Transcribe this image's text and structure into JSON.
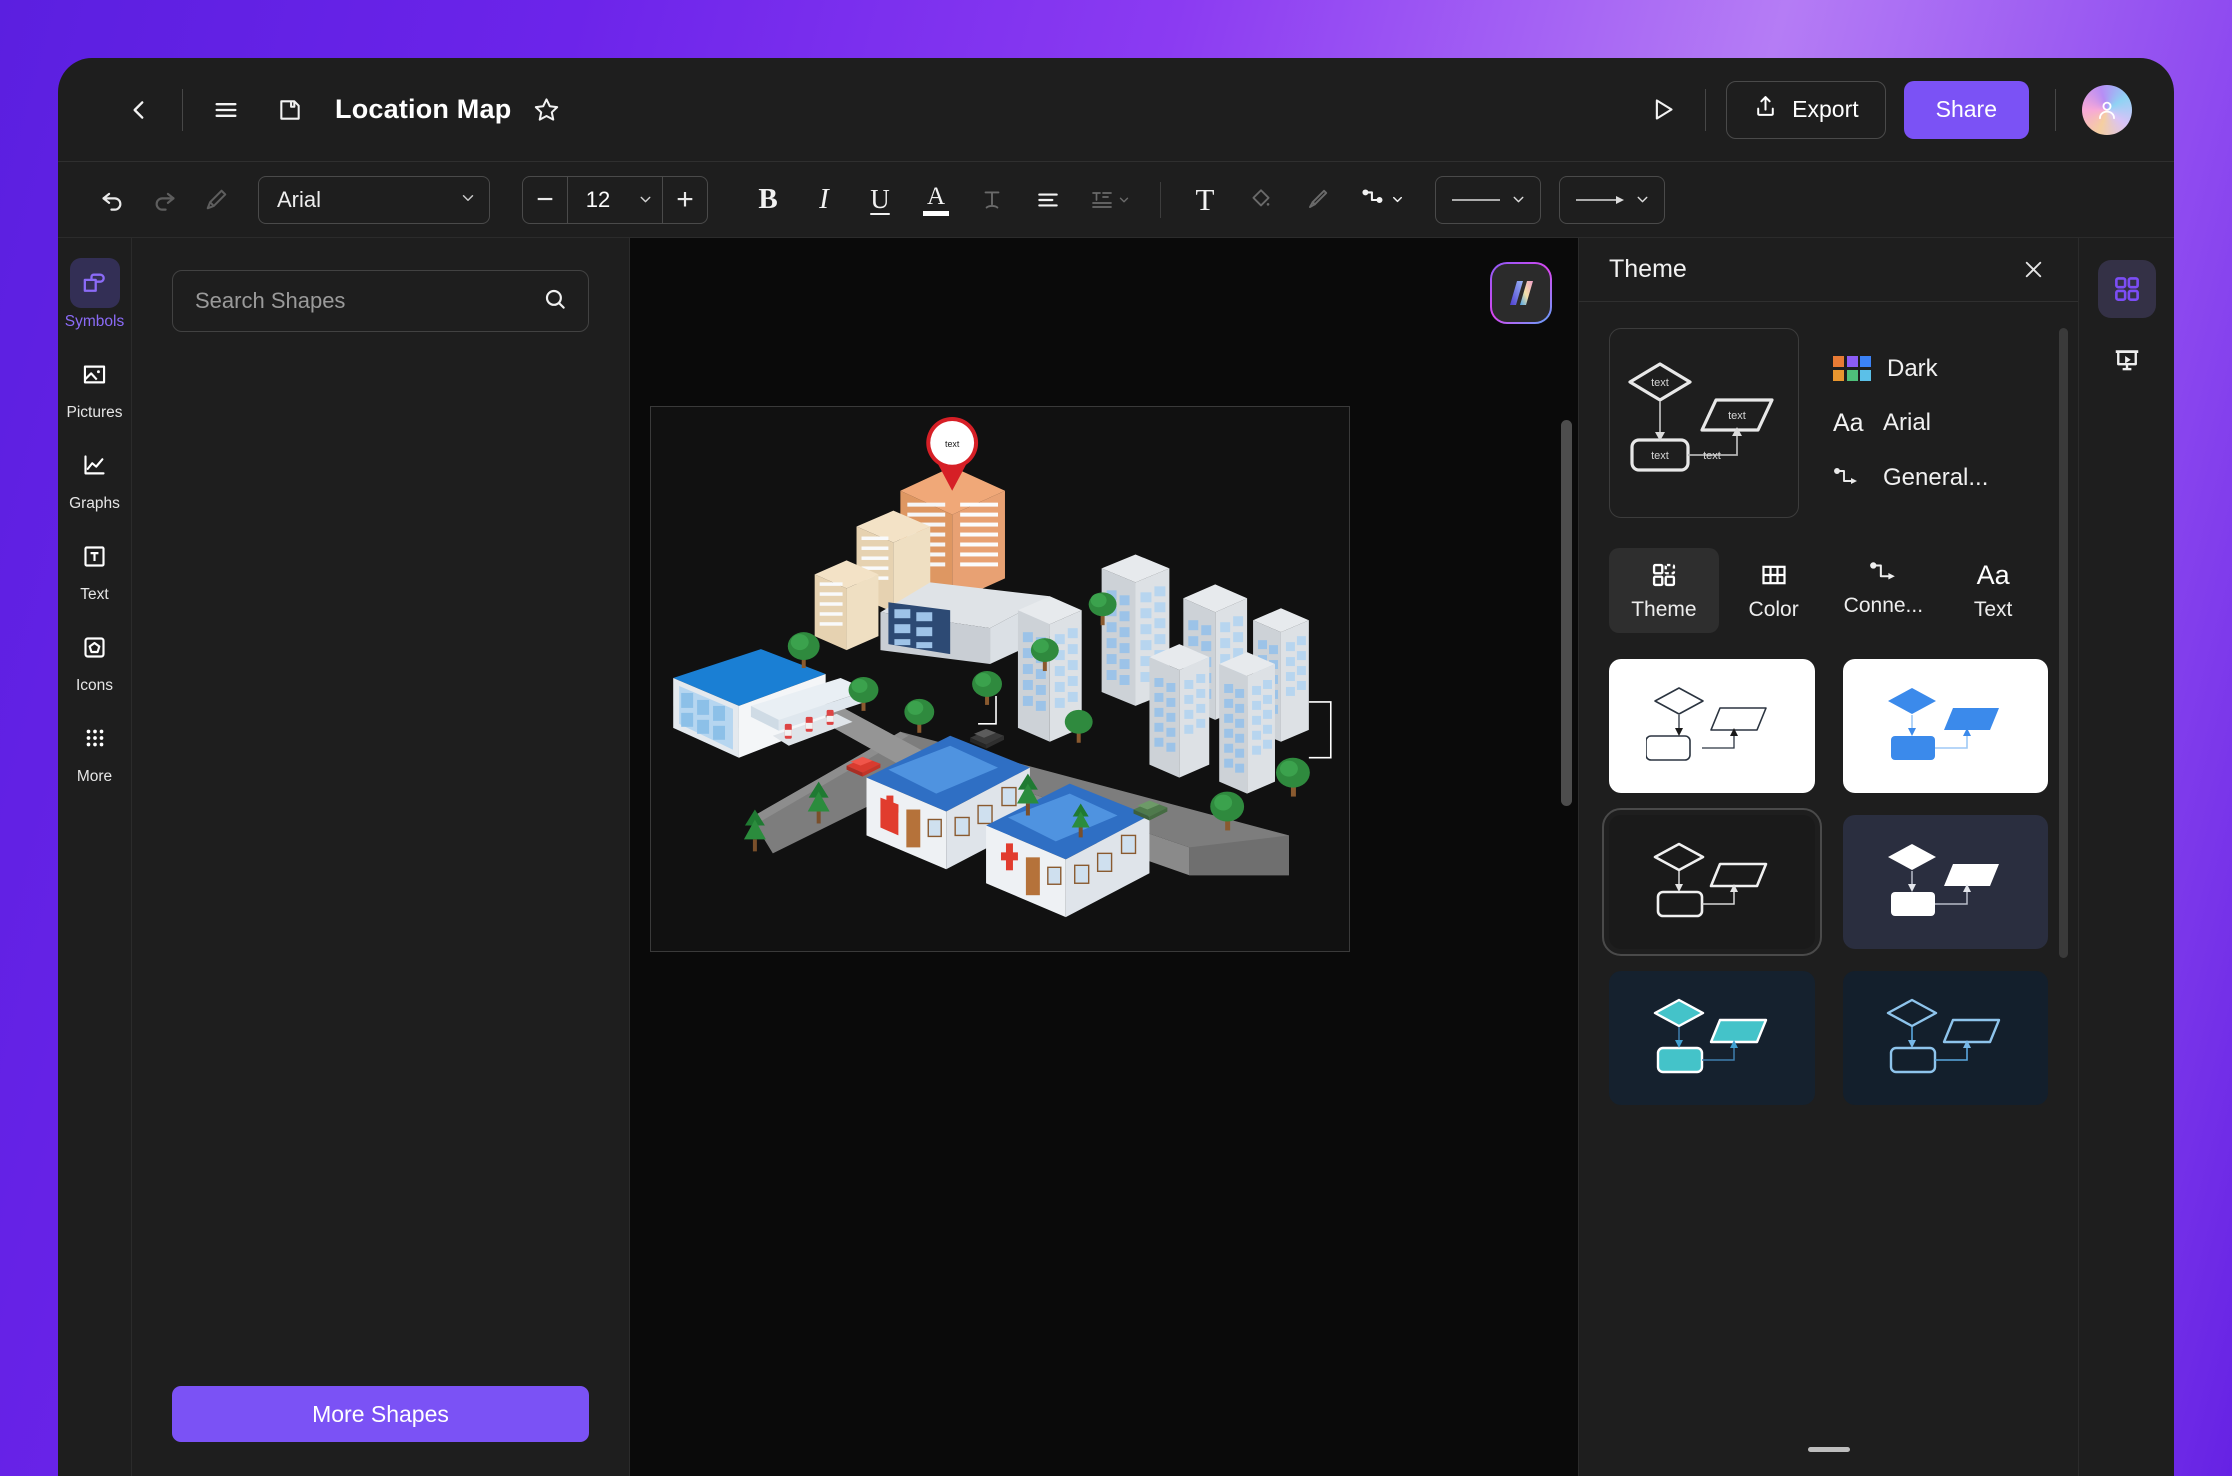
{
  "header": {
    "back_icon": "chevron-left-icon",
    "menu_icon": "hamburger-menu-icon",
    "save_icon": "save-disk-icon",
    "title": "Location Map",
    "favorite_icon": "star-outline-icon",
    "present_icon": "play-triangle-icon",
    "export_label": "Export",
    "export_icon": "share-upload-icon",
    "share_label": "Share",
    "avatar_icon": "user-avatar",
    "accent_color": "#7b52f5"
  },
  "toolbar": {
    "undo_icon": "undo-arrow-icon",
    "redo_icon": "redo-arrow-icon",
    "format_painter_icon": "format-painter-icon",
    "font_family": "Arial",
    "font_size": "12",
    "decrease_label": "−",
    "increase_label": "+",
    "bold_label": "B",
    "italic_label": "I",
    "underline_label": "U",
    "font_color_label": "A",
    "strikethrough_label": "T",
    "align_icon": "align-left-icon",
    "line_spacing_icon": "line-spacing-icon",
    "text_box_label": "T",
    "fill_icon": "fill-bucket-icon",
    "brush_icon": "paint-brush-icon",
    "connector_icon": "connector-elbow-icon",
    "line_style_icon": "line-style-icon",
    "arrow_style_icon": "arrow-style-icon"
  },
  "left_rail": {
    "items": [
      {
        "label": "Symbols",
        "icon": "symbols-shapes-icon",
        "active": true
      },
      {
        "label": "Pictures",
        "icon": "picture-image-icon",
        "active": false
      },
      {
        "label": "Graphs",
        "icon": "line-chart-icon",
        "active": false
      },
      {
        "label": "Text",
        "icon": "text-box-icon",
        "active": false
      },
      {
        "label": "Icons",
        "icon": "pentagon-icon",
        "active": false
      },
      {
        "label": "More",
        "icon": "grid-dots-icon",
        "active": false
      }
    ]
  },
  "shapes_panel": {
    "search_placeholder": "Search Shapes",
    "search_value": "",
    "search_icon": "magnifier-search-icon",
    "more_shapes_label": "More Shapes"
  },
  "canvas": {
    "logo_badge_icon": "wondershare-edrawmax-logo",
    "map_pin_label": "text",
    "background_color": "#0a0a0a",
    "page_color": "#111111"
  },
  "theme_panel": {
    "title": "Theme",
    "close_icon": "close-x-icon",
    "preview_card": {
      "icon": "flowchart-preview-diagram",
      "node_labels": [
        "text",
        "text",
        "text",
        "text"
      ]
    },
    "meta": [
      {
        "label": "Dark",
        "icon": "color-swatch-grid-icon"
      },
      {
        "label": "Arial",
        "icon": "font-aa-icon"
      },
      {
        "label": "General...",
        "icon": "connector-elbow-icon"
      }
    ],
    "tabs": [
      {
        "label": "Theme",
        "icon": "grid-four-squares-icon",
        "active": true
      },
      {
        "label": "Color",
        "icon": "color-table-icon",
        "active": false
      },
      {
        "label": "Conne...",
        "icon": "connector-elbow-icon",
        "active": false
      },
      {
        "label": "Text",
        "icon": "font-aa-icon",
        "active": false
      }
    ],
    "theme_cards": [
      {
        "name": "light-outline",
        "bg": "#ffffff",
        "shape_fill": "#ffffff",
        "stroke": "#2b3440",
        "connector": "#2b3440",
        "selected": false
      },
      {
        "name": "light-blue-filled",
        "bg": "#ffffff",
        "shape_fill": "#3b8aeb",
        "stroke": "#3b8aeb",
        "connector": "#9fc9f5",
        "selected": false
      },
      {
        "name": "dark-outline",
        "bg": "#1a1a1a",
        "shape_fill": "#1a1a1a",
        "stroke": "#f0f0f0",
        "connector": "#d8d8d8",
        "selected": true
      },
      {
        "name": "navy-white-filled",
        "bg": "#2a2e3f",
        "shape_fill": "#ffffff",
        "stroke": "#ffffff",
        "connector": "#b8bcc8",
        "selected": false
      },
      {
        "name": "navy-teal-filled",
        "bg": "#15212e",
        "shape_fill": "#44c3c9",
        "stroke": "#ffffff",
        "connector": "#3f7fae",
        "selected": false
      },
      {
        "name": "navy-blue-outline",
        "bg": "#131f2c",
        "shape_fill": "#131f2c",
        "stroke": "#8ec4ec",
        "connector": "#5aa8e0",
        "selected": false
      }
    ],
    "collapse_handle_icon": "panel-collapse-handle"
  },
  "right_rail": {
    "items": [
      {
        "icon": "grid-four-squares-icon",
        "name": "theme-panel-toggle",
        "active": true
      },
      {
        "icon": "presentation-play-icon",
        "name": "presentation-toggle",
        "active": false
      }
    ]
  }
}
